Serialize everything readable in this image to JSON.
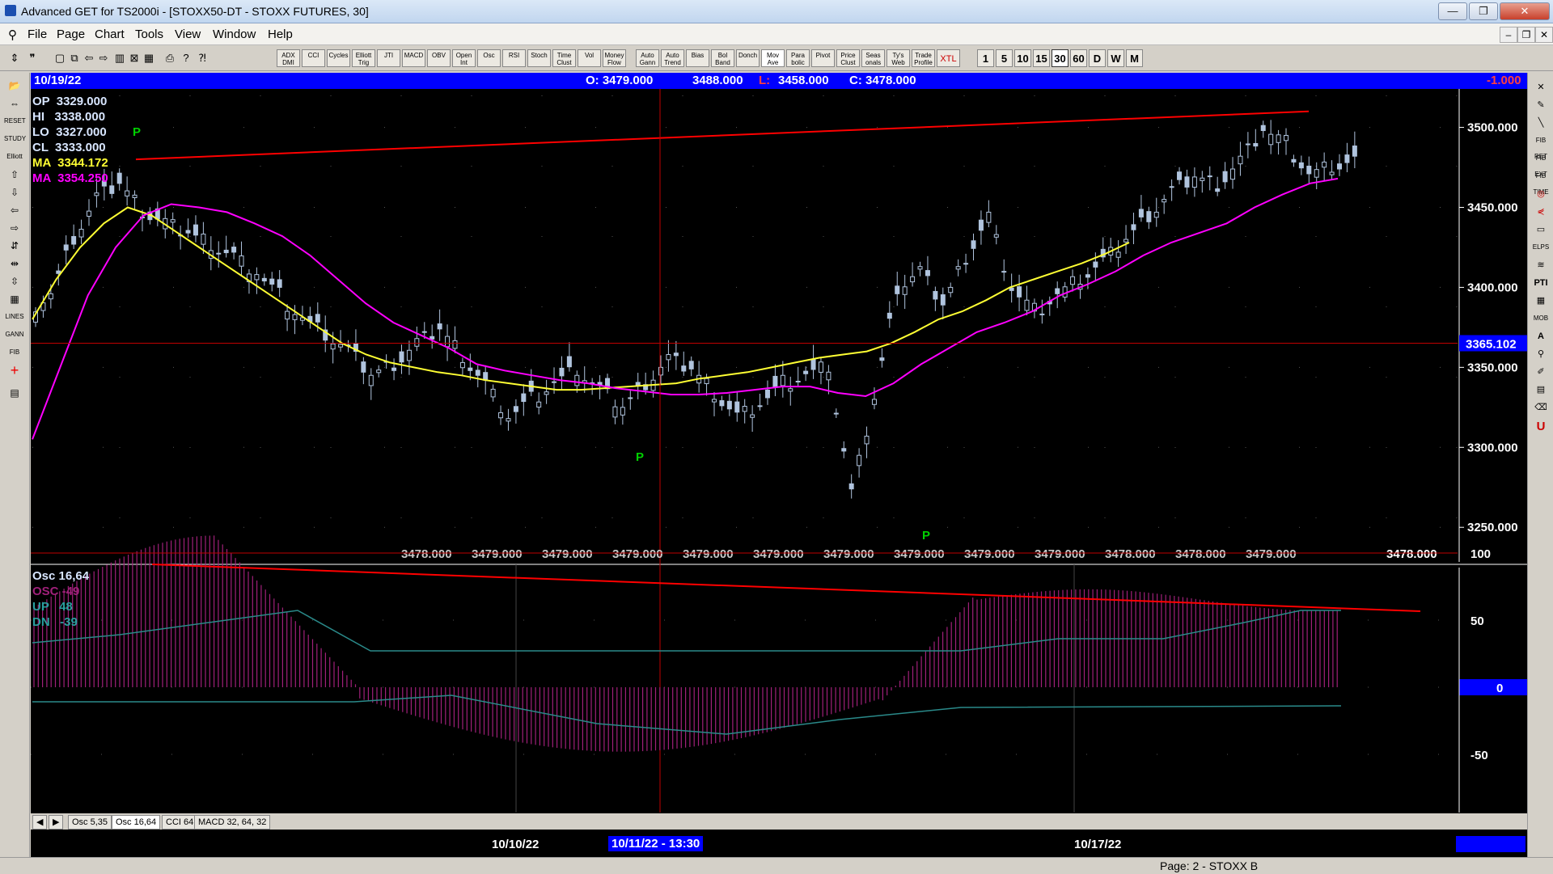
{
  "window": {
    "title": "Advanced GET for TS2000i - [STOXX50-DT - STOXX FUTURES, 30]",
    "minimize": "—",
    "restore": "❐",
    "close": "✕"
  },
  "menu": [
    "File",
    "Page",
    "Chart",
    "Tools",
    "View",
    "Window",
    "Help"
  ],
  "toolbar": {
    "studies": [
      "ADX DMI",
      "CCI",
      "Cycles",
      "Elliott Trig",
      "JTI",
      "MACD",
      "OBV",
      "Open Int",
      "Osc",
      "RSI",
      "Stoch",
      "Time Clust",
      "Vol",
      "Money Flow",
      "Auto Gann",
      "Auto Trend",
      "Bias",
      "Bol Band",
      "Donch",
      "Mov Ave",
      "Para bolic",
      "Pivot",
      "Price Clust",
      "Seas onals",
      "Ty's Web",
      "Trade Profile",
      "XTL"
    ],
    "timeframes": [
      "1",
      "5",
      "10",
      "15",
      "30",
      "60",
      "D",
      "W",
      "M"
    ],
    "active_timeframe": "30"
  },
  "header": {
    "date": "10/19/22",
    "open": "O: 3479.000",
    "high": "3488.000",
    "low_label": "L:",
    "low": "3458.000",
    "close": "C: 3478.000",
    "change": "-1.000"
  },
  "legend": {
    "op": "OP  3329.000",
    "hi": "HI   3338.000",
    "lo": "LO  3327.000",
    "cl": "CL  3333.000",
    "ma1": "MA  3344.172",
    "ma2": "MA  3354.250"
  },
  "price_axis": [
    "3500.000",
    "3450.000",
    "3400.000",
    "3350.000",
    "3300.000",
    "3250.000"
  ],
  "cursor_price": "3365.102",
  "bottom_prices": [
    "3478.000",
    "3479.000",
    "3479.000",
    "3479.000",
    "3479.000",
    "3479.000",
    "3479.000",
    "3479.000",
    "3479.000",
    "3479.000",
    "3478.000",
    "3478.000",
    "3479.000",
    "3479.000"
  ],
  "last_price": "3478.000",
  "pivot_label": "P",
  "osc": {
    "title": "Osc 16,64",
    "osc": "OSC -49",
    "up": "UP   48",
    "dn": "DN   -39",
    "axis": [
      "100",
      "50",
      "0",
      "-50"
    ]
  },
  "tabs": [
    "Osc 5,35",
    "Osc 16,64",
    "CCI 64",
    "MACD 32, 64, 32"
  ],
  "active_tab": "Osc 16,64",
  "dates": [
    "10/10/22",
    "10/11/22 - 13:30",
    "10/17/22"
  ],
  "status": "Page: 2 - STOXX B",
  "colors": {
    "ma_fast": "#ffff33",
    "ma_slow": "#ff00ff",
    "trendline": "#ff0000",
    "candle": "#b0c4de",
    "osc_hist": "#a0207a",
    "osc_bands": "#2a8a8a",
    "header_bg": "#0000ff"
  },
  "chart_data": {
    "type": "line",
    "title": "STOXX50-DT - STOXX FUTURES, 30",
    "xlabel": "",
    "ylabel": "",
    "ylim": [
      3240,
      3520
    ],
    "x_ticks": [
      "10/10/22",
      "10/11/22 - 13:30",
      "10/17/22"
    ],
    "series": [
      {
        "name": "Close",
        "values": [
          3395,
          3430,
          3455,
          3465,
          3448,
          3440,
          3435,
          3428,
          3420,
          3410,
          3395,
          3380,
          3370,
          3360,
          3345,
          3352,
          3365,
          3375,
          3358,
          3340,
          3320,
          3330,
          3340,
          3348,
          3335,
          3325,
          3340,
          3355,
          3350,
          3335,
          3320,
          3328,
          3340,
          3345,
          3350,
          3270,
          3330,
          3400,
          3410,
          3390,
          3420,
          3445,
          3400,
          3385,
          3395,
          3405,
          3415,
          3430,
          3445,
          3460,
          3470,
          3465,
          3480,
          3500,
          3490,
          3470,
          3475,
          3478
        ]
      },
      {
        "name": "MA",
        "values": [
          3380,
          3405,
          3425,
          3440,
          3450,
          3445,
          3435,
          3425,
          3415,
          3405,
          3395,
          3385,
          3375,
          3365,
          3358,
          3353,
          3350,
          3347,
          3345,
          3342,
          3340,
          3338,
          3336,
          3336,
          3337,
          3338,
          3339,
          3340,
          3343,
          3345,
          3347,
          3350,
          3353,
          3356,
          3358,
          3360,
          3365,
          3372,
          3380,
          3385,
          3392,
          3400,
          3405,
          3410,
          3415,
          3421,
          3428
        ]
      },
      {
        "name": "MA",
        "values": [
          3305,
          3350,
          3395,
          3425,
          3445,
          3452,
          3450,
          3447,
          3440,
          3432,
          3420,
          3405,
          3390,
          3378,
          3370,
          3362,
          3352,
          3348,
          3345,
          3342,
          3340,
          3337,
          3335,
          3333,
          3333,
          3334,
          3336,
          3338,
          3338,
          3334,
          3332,
          3340,
          3352,
          3362,
          3372,
          3378,
          3385,
          3395,
          3402,
          3410,
          3420,
          3428,
          3434,
          3440,
          3450,
          3458,
          3465,
          3468
        ]
      }
    ]
  }
}
